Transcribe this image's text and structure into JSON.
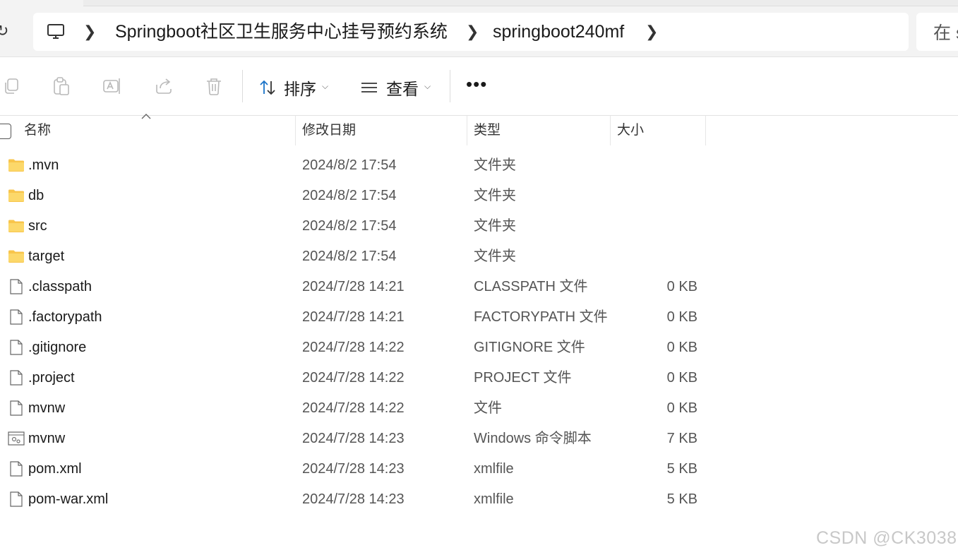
{
  "address_bar": {
    "refresh_icon": "refresh-icon",
    "location_icon": "this-pc-icon",
    "breadcrumb": [
      "Springboot社区卫生服务中心挂号预约系统",
      "springboot240mf"
    ],
    "search_placeholder": "在 s"
  },
  "toolbar": {
    "icons": [
      "copy-icon",
      "paste-icon",
      "rename-icon",
      "share-icon",
      "delete-icon"
    ],
    "sort_label": "排序",
    "view_label": "查看",
    "more_label": "•••"
  },
  "columns": {
    "name": "名称",
    "date": "修改日期",
    "type": "类型",
    "size": "大小"
  },
  "files": [
    {
      "name": ".mvn",
      "date": "2024/8/2 17:54",
      "type": "文件夹",
      "size": "",
      "icon": "folder-icon"
    },
    {
      "name": "db",
      "date": "2024/8/2 17:54",
      "type": "文件夹",
      "size": "",
      "icon": "folder-icon"
    },
    {
      "name": "src",
      "date": "2024/8/2 17:54",
      "type": "文件夹",
      "size": "",
      "icon": "folder-icon"
    },
    {
      "name": "target",
      "date": "2024/8/2 17:54",
      "type": "文件夹",
      "size": "",
      "icon": "folder-icon"
    },
    {
      "name": ".classpath",
      "date": "2024/7/28 14:21",
      "type": "CLASSPATH 文件",
      "size": "0 KB",
      "icon": "file-icon"
    },
    {
      "name": ".factorypath",
      "date": "2024/7/28 14:21",
      "type": "FACTORYPATH 文件",
      "size": "0 KB",
      "icon": "file-icon"
    },
    {
      "name": ".gitignore",
      "date": "2024/7/28 14:22",
      "type": "GITIGNORE 文件",
      "size": "0 KB",
      "icon": "file-icon"
    },
    {
      "name": ".project",
      "date": "2024/7/28 14:22",
      "type": "PROJECT 文件",
      "size": "0 KB",
      "icon": "file-icon"
    },
    {
      "name": "mvnw",
      "date": "2024/7/28 14:22",
      "type": "文件",
      "size": "0 KB",
      "icon": "file-icon"
    },
    {
      "name": "mvnw",
      "date": "2024/7/28 14:23",
      "type": "Windows 命令脚本",
      "size": "7 KB",
      "icon": "script-icon"
    },
    {
      "name": "pom.xml",
      "date": "2024/7/28 14:23",
      "type": "xmlfile",
      "size": "5 KB",
      "icon": "file-icon"
    },
    {
      "name": "pom-war.xml",
      "date": "2024/7/28 14:23",
      "type": "xmlfile",
      "size": "5 KB",
      "icon": "file-icon"
    }
  ],
  "watermark": "CSDN @CK3038",
  "colors": {
    "folder": "#f8c54b",
    "accent": "#1a73c8"
  }
}
